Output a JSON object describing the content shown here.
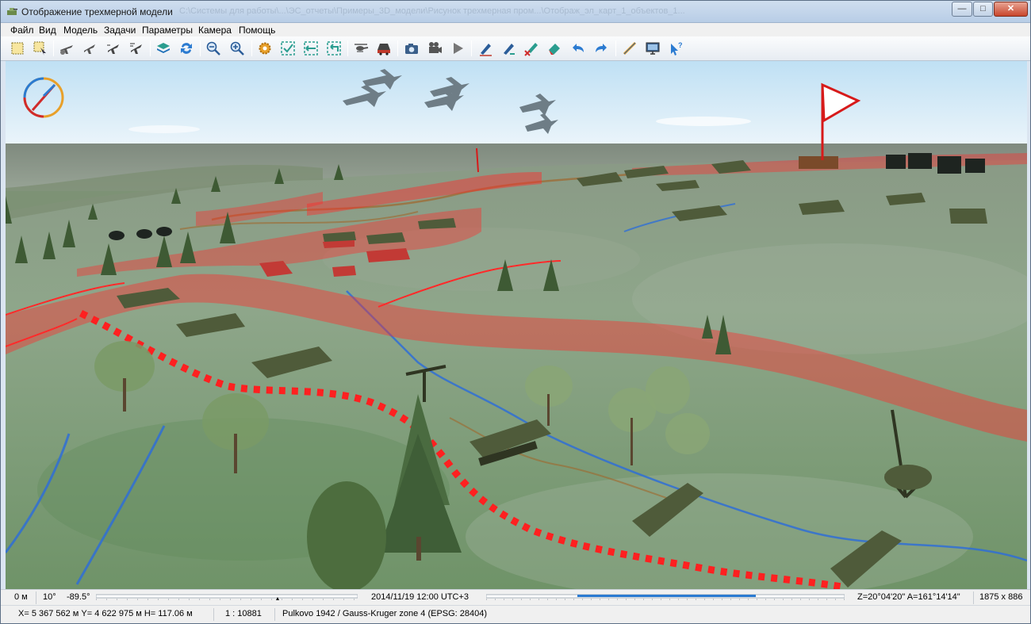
{
  "window": {
    "title": "Отображение трехмерной модели",
    "ghost_title": "C:\\Системы для работы\\...\\ЭС_отчеты\\Примеры_3D_модели\\Рисунок трехмерная пром...\\Отображ_эл_карт_1_объектов_1..."
  },
  "window_controls": {
    "minimize": "—",
    "maximize": "□",
    "close": "✕"
  },
  "menu": [
    "Файл",
    "Вид",
    "Модель",
    "Задачи",
    "Параметры",
    "Камера",
    "Помощь"
  ],
  "toolbar_icons": [
    "select-rect-icon",
    "select-object-icon",
    "plane-1-icon",
    "plane-2-icon",
    "plane-3-icon",
    "plane-4-icon",
    "layers-icon",
    "refresh-icon",
    "zoom-out-icon",
    "zoom-in-icon",
    "settings-gear-icon",
    "check-fit-icon",
    "fit-horizontal-icon",
    "fit-back-icon",
    "helicopter-icon",
    "vehicle-icon",
    "camera-icon",
    "video-camera-icon",
    "play-icon",
    "pen-edit-icon",
    "pen-edit-2-icon",
    "delete-x-icon",
    "eraser-icon",
    "undo-icon",
    "redo-icon",
    "draw-line-icon",
    "monitor-icon",
    "help-pointer-icon"
  ],
  "status": {
    "distance": "0 м",
    "tilt": "10°",
    "heading": "-89.5°",
    "datetime": "2014/11/19   12:00   UTC+3",
    "angles": "Z=20°04'20\"   A=161°14'14\"",
    "resolution": "1875 x 886",
    "coords": "X= 5 367 562 м  Y= 4 622 975 м  H= 117.06 м",
    "scale": "1 : 10881",
    "projection": "Pulkovo 1942 / Gauss-Kruger zone 4 (EPSG: 28404)"
  },
  "colors": {
    "accent_red": "#ff2a2a",
    "terrain_green": "#7fa27a",
    "sky": "#cfe6f5",
    "river_blue": "#2f6fd6"
  }
}
